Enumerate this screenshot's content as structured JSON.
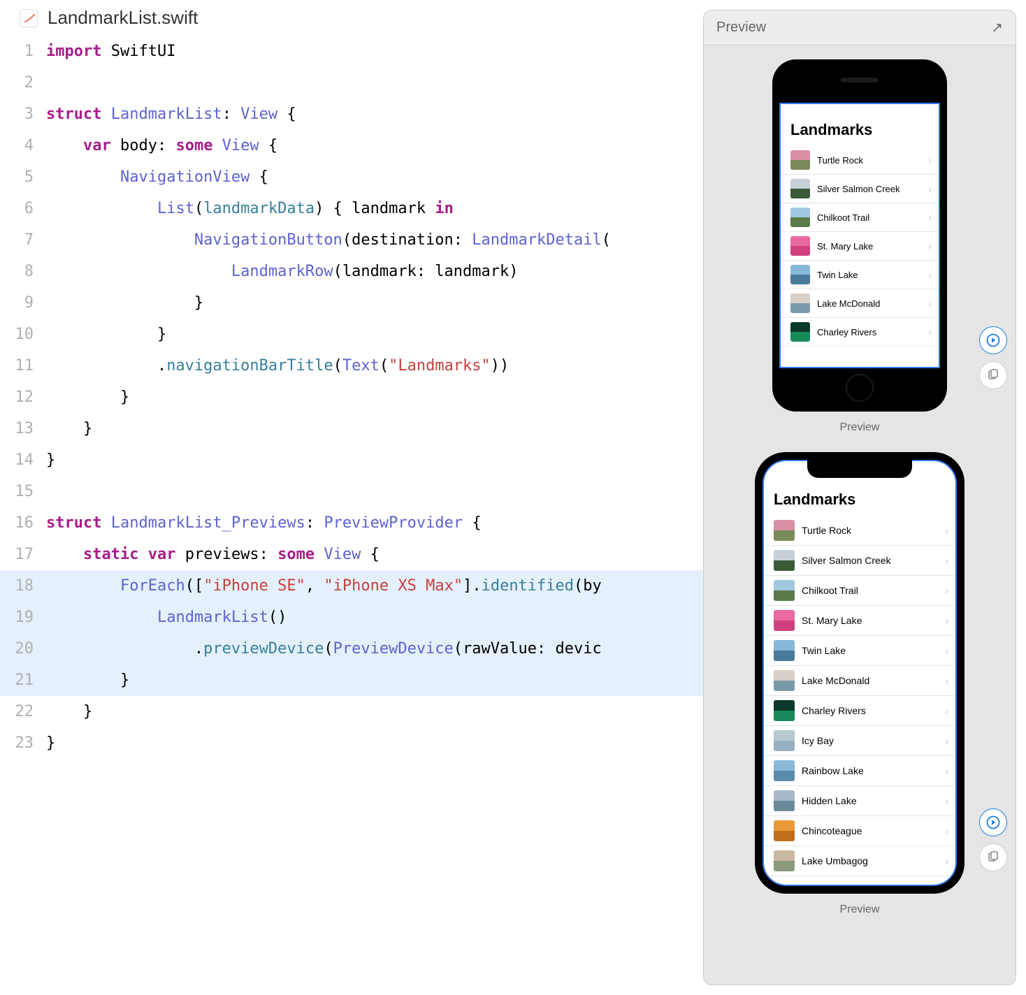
{
  "file": {
    "name": "LandmarkList.swift",
    "icon": "swift"
  },
  "code": {
    "lines": [
      {
        "n": 1,
        "hl": false,
        "tokens": [
          [
            "keyword",
            "import"
          ],
          [
            "plain",
            " "
          ],
          [
            "plain",
            "SwiftUI"
          ]
        ]
      },
      {
        "n": 2,
        "hl": false,
        "tokens": []
      },
      {
        "n": 3,
        "hl": false,
        "tokens": [
          [
            "keyword",
            "struct"
          ],
          [
            "plain",
            " "
          ],
          [
            "type",
            "LandmarkList"
          ],
          [
            "plain",
            ": "
          ],
          [
            "type",
            "View"
          ],
          [
            "plain",
            " {"
          ]
        ]
      },
      {
        "n": 4,
        "hl": false,
        "tokens": [
          [
            "plain",
            "    "
          ],
          [
            "keyword",
            "var"
          ],
          [
            "plain",
            " body: "
          ],
          [
            "keyword",
            "some"
          ],
          [
            "plain",
            " "
          ],
          [
            "type",
            "View"
          ],
          [
            "plain",
            " {"
          ]
        ]
      },
      {
        "n": 5,
        "hl": false,
        "tokens": [
          [
            "plain",
            "        "
          ],
          [
            "type",
            "NavigationView"
          ],
          [
            "plain",
            " {"
          ]
        ]
      },
      {
        "n": 6,
        "hl": false,
        "tokens": [
          [
            "plain",
            "            "
          ],
          [
            "type",
            "List"
          ],
          [
            "plain",
            "("
          ],
          [
            "param",
            "landmarkData"
          ],
          [
            "plain",
            ") { landmark "
          ],
          [
            "keyword",
            "in"
          ]
        ]
      },
      {
        "n": 7,
        "hl": false,
        "tokens": [
          [
            "plain",
            "                "
          ],
          [
            "type",
            "NavigationButton"
          ],
          [
            "plain",
            "(destination: "
          ],
          [
            "type",
            "LandmarkDetail"
          ],
          [
            "plain",
            "("
          ]
        ]
      },
      {
        "n": 8,
        "hl": false,
        "tokens": [
          [
            "plain",
            "                    "
          ],
          [
            "type",
            "LandmarkRow"
          ],
          [
            "plain",
            "(landmark: landmark)"
          ]
        ]
      },
      {
        "n": 9,
        "hl": false,
        "tokens": [
          [
            "plain",
            "                }"
          ]
        ]
      },
      {
        "n": 10,
        "hl": false,
        "tokens": [
          [
            "plain",
            "            }"
          ]
        ]
      },
      {
        "n": 11,
        "hl": false,
        "tokens": [
          [
            "plain",
            "            ."
          ],
          [
            "func",
            "navigationBarTitle"
          ],
          [
            "plain",
            "("
          ],
          [
            "type",
            "Text"
          ],
          [
            "plain",
            "("
          ],
          [
            "string",
            "\"Landmarks\""
          ],
          [
            "plain",
            "))"
          ]
        ]
      },
      {
        "n": 12,
        "hl": false,
        "tokens": [
          [
            "plain",
            "        }"
          ]
        ]
      },
      {
        "n": 13,
        "hl": false,
        "tokens": [
          [
            "plain",
            "    }"
          ]
        ]
      },
      {
        "n": 14,
        "hl": false,
        "tokens": [
          [
            "plain",
            "}"
          ]
        ]
      },
      {
        "n": 15,
        "hl": false,
        "tokens": []
      },
      {
        "n": 16,
        "hl": false,
        "tokens": [
          [
            "keyword",
            "struct"
          ],
          [
            "plain",
            " "
          ],
          [
            "type",
            "LandmarkList_Previews"
          ],
          [
            "plain",
            ": "
          ],
          [
            "type",
            "PreviewProvider"
          ],
          [
            "plain",
            " {"
          ]
        ]
      },
      {
        "n": 17,
        "hl": false,
        "tokens": [
          [
            "plain",
            "    "
          ],
          [
            "keyword",
            "static"
          ],
          [
            "plain",
            " "
          ],
          [
            "keyword",
            "var"
          ],
          [
            "plain",
            " previews: "
          ],
          [
            "keyword",
            "some"
          ],
          [
            "plain",
            " "
          ],
          [
            "type",
            "View"
          ],
          [
            "plain",
            " {"
          ]
        ]
      },
      {
        "n": 18,
        "hl": true,
        "tokens": [
          [
            "plain",
            "        "
          ],
          [
            "type",
            "ForEach"
          ],
          [
            "plain",
            "(["
          ],
          [
            "string",
            "\"iPhone SE\""
          ],
          [
            "plain",
            ", "
          ],
          [
            "string",
            "\"iPhone XS Max\""
          ],
          [
            "plain",
            "]."
          ],
          [
            "func",
            "identified"
          ],
          [
            "plain",
            "(by"
          ]
        ]
      },
      {
        "n": 19,
        "hl": true,
        "tokens": [
          [
            "plain",
            "            "
          ],
          [
            "type",
            "LandmarkList"
          ],
          [
            "plain",
            "()"
          ]
        ]
      },
      {
        "n": 20,
        "hl": true,
        "tokens": [
          [
            "plain",
            "                ."
          ],
          [
            "func",
            "previewDevice"
          ],
          [
            "plain",
            "("
          ],
          [
            "type",
            "PreviewDevice"
          ],
          [
            "plain",
            "(rawValue: devic"
          ]
        ]
      },
      {
        "n": 21,
        "hl": true,
        "tokens": [
          [
            "plain",
            "        }"
          ]
        ]
      },
      {
        "n": 22,
        "hl": false,
        "tokens": [
          [
            "plain",
            "    }"
          ]
        ]
      },
      {
        "n": 23,
        "hl": false,
        "tokens": [
          [
            "plain",
            "}"
          ]
        ]
      }
    ]
  },
  "preview": {
    "header": "Preview",
    "caption": "Preview",
    "screen_title": "Landmarks",
    "landmarks": [
      {
        "name": "Turtle Rock",
        "color1": "#d98fa5",
        "color2": "#7a8a5a"
      },
      {
        "name": "Silver Salmon Creek",
        "color1": "#c7d0d8",
        "color2": "#3a5a3a"
      },
      {
        "name": "Chilkoot Trail",
        "color1": "#a0c8e0",
        "color2": "#5a7a4a"
      },
      {
        "name": "St. Mary Lake",
        "color1": "#e86aa0",
        "color2": "#d04080"
      },
      {
        "name": "Twin Lake",
        "color1": "#87b8d8",
        "color2": "#4a7a9a"
      },
      {
        "name": "Lake McDonald",
        "color1": "#d8d0c8",
        "color2": "#7a9aaa"
      },
      {
        "name": "Charley Rivers",
        "color1": "#0a3a2a",
        "color2": "#1a8a5a"
      },
      {
        "name": "Icy Bay",
        "color1": "#b8c8d0",
        "color2": "#9ab0c0"
      },
      {
        "name": "Rainbow Lake",
        "color1": "#8ab8d8",
        "color2": "#5a8aaa"
      },
      {
        "name": "Hidden Lake",
        "color1": "#a8b8c8",
        "color2": "#6a8a9a"
      },
      {
        "name": "Chincoteague",
        "color1": "#e89a3a",
        "color2": "#c0701a"
      },
      {
        "name": "Lake Umbagog",
        "color1": "#c8b8a0",
        "color2": "#8a9a7a"
      }
    ],
    "se_visible_count": 7,
    "xsmax_visible_count": 12
  }
}
